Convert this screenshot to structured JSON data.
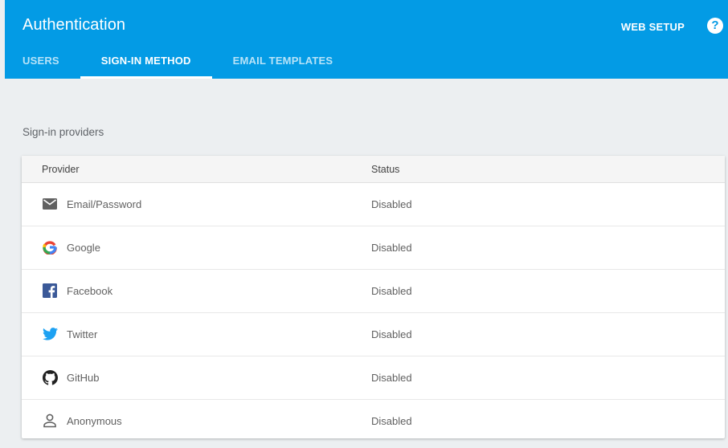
{
  "header": {
    "title": "Authentication",
    "web_setup": "WEB SETUP",
    "help": "?"
  },
  "tabs": [
    {
      "label": "USERS",
      "active": false
    },
    {
      "label": "SIGN-IN METHOD",
      "active": true
    },
    {
      "label": "EMAIL TEMPLATES",
      "active": false
    }
  ],
  "section": {
    "title": "Sign-in providers"
  },
  "table": {
    "columns": [
      "Provider",
      "Status"
    ],
    "rows": [
      {
        "icon": "email-icon",
        "provider": "Email/Password",
        "status": "Disabled"
      },
      {
        "icon": "google-icon",
        "provider": "Google",
        "status": "Disabled"
      },
      {
        "icon": "facebook-icon",
        "provider": "Facebook",
        "status": "Disabled"
      },
      {
        "icon": "twitter-icon",
        "provider": "Twitter",
        "status": "Disabled"
      },
      {
        "icon": "github-icon",
        "provider": "GitHub",
        "status": "Disabled"
      },
      {
        "icon": "anonymous-user-icon",
        "provider": "Anonymous",
        "status": "Disabled"
      }
    ]
  },
  "colors": {
    "header_bg": "#039be5",
    "page_bg": "#eceff1"
  }
}
